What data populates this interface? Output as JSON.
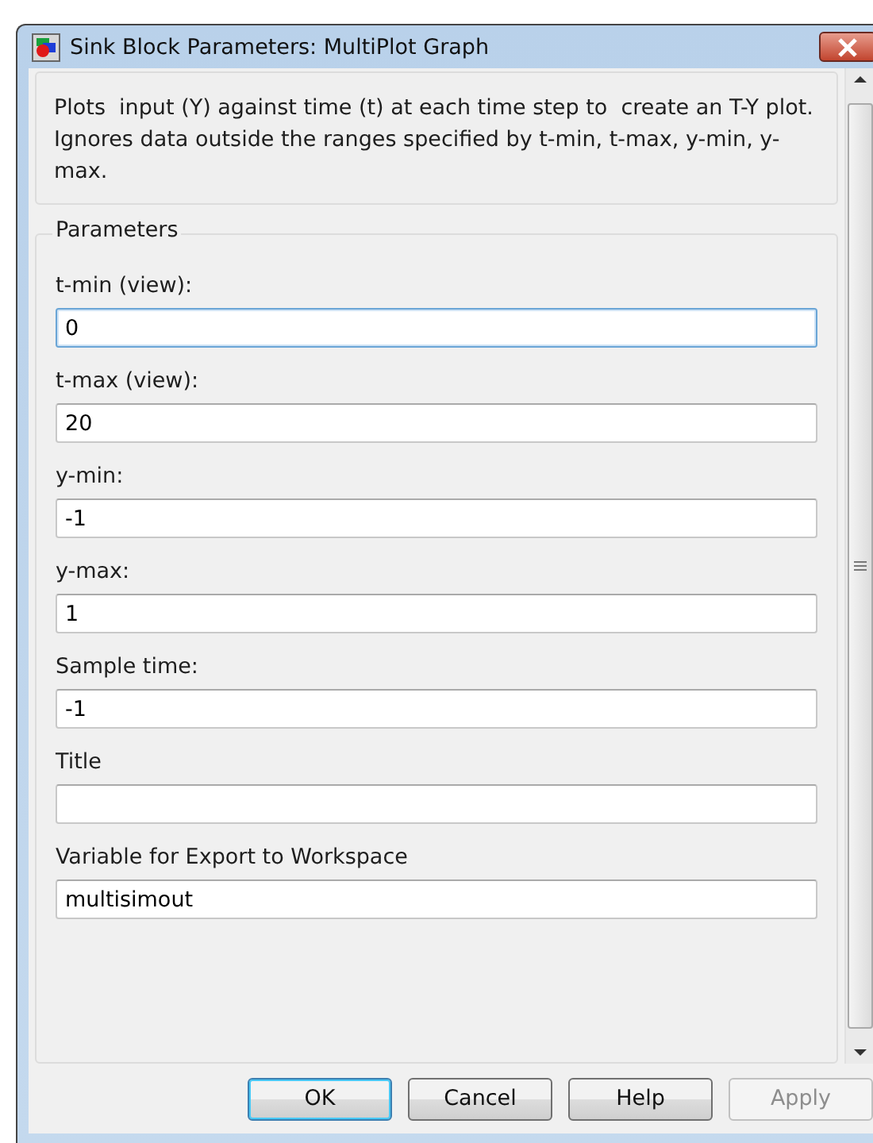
{
  "window": {
    "title": "Sink Block Parameters: MultiPlot Graph"
  },
  "description": "Plots  input (Y) against time (t) at each time step to  create an T-Y plot. Ignores data outside the ranges specified by t-min, t-max, y-min, y-max.",
  "parameters": {
    "title": "Parameters",
    "fields": [
      {
        "label": "t-min (view):",
        "value": "0",
        "focused": true
      },
      {
        "label": "t-max (view):",
        "value": "20",
        "focused": false
      },
      {
        "label": "y-min:",
        "value": "-1",
        "focused": false
      },
      {
        "label": "y-max:",
        "value": "1",
        "focused": false
      },
      {
        "label": "Sample time:",
        "value": "-1",
        "focused": false
      },
      {
        "label": "Title",
        "focused": false
      },
      {
        "label": "Variable for Export to Workspace",
        "value": "multisimout",
        "focused": false
      }
    ]
  },
  "buttons": [
    {
      "label": "OK",
      "default": true,
      "disabled": false
    },
    {
      "label": "Cancel",
      "default": false,
      "disabled": false
    },
    {
      "label": "Help",
      "default": false,
      "disabled": false
    },
    {
      "label": "Apply",
      "default": false,
      "disabled": true
    }
  ]
}
